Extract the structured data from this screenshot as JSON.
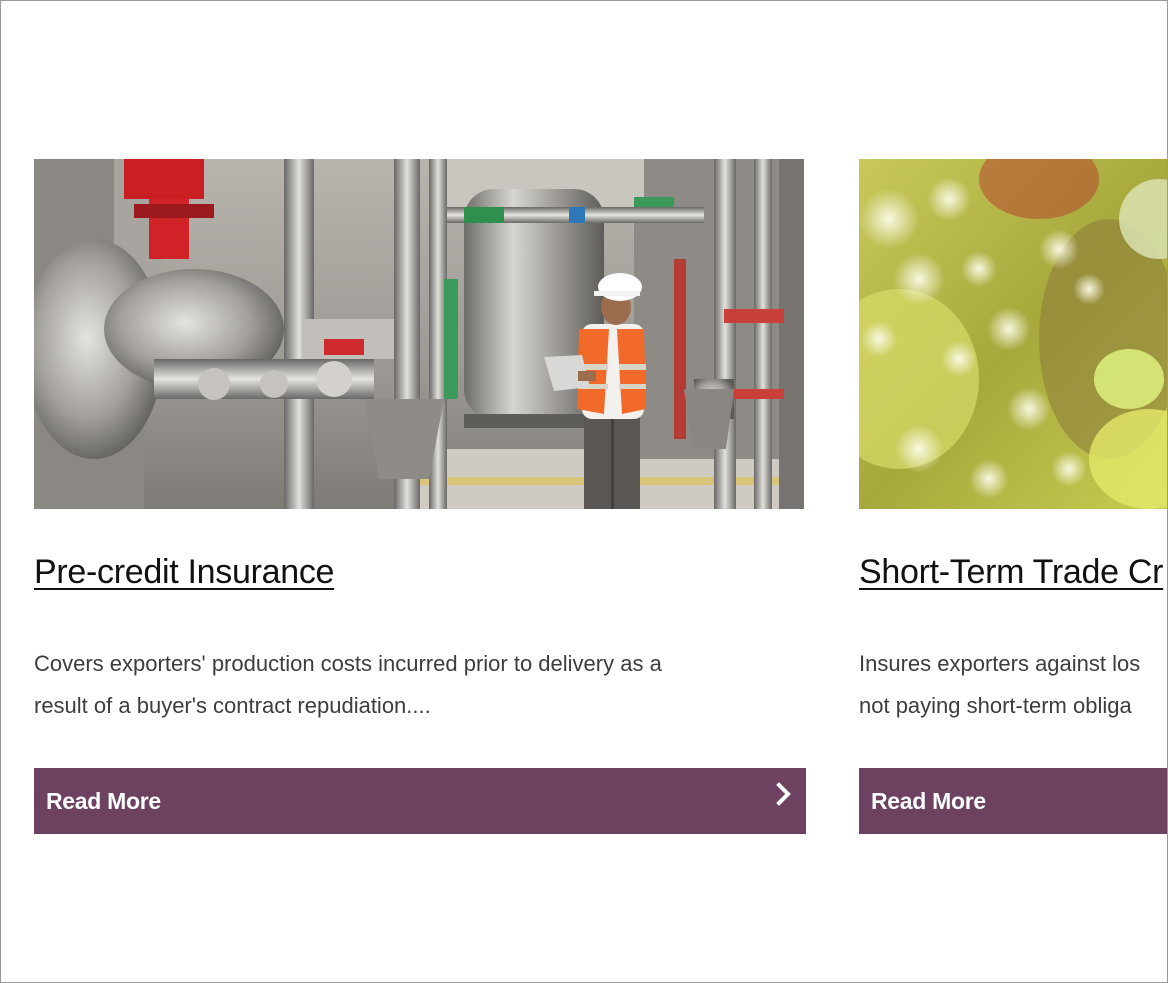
{
  "cards": [
    {
      "title": "Pre-credit Insurance",
      "description_lines": [
        "Covers exporters' production costs incurred prior to delivery as a",
        "result of a buyer's contract repudiation...."
      ],
      "button_label": "Read More",
      "image_subject": "industrial plant with worker in hard hat and safety vest"
    },
    {
      "title": "Short-Term Trade Cr",
      "description_lines": [
        "Insures exporters against los",
        "not paying short-term obliga"
      ],
      "button_label": "Read More",
      "image_subject": "blurred green and yellow foliage"
    }
  ],
  "colors": {
    "button_bg": "#6d4260",
    "button_text": "#ffffff",
    "title_text": "#111111",
    "body_text": "#3d3d3d"
  },
  "icons": {
    "button_icon": "chevron-right-icon"
  }
}
